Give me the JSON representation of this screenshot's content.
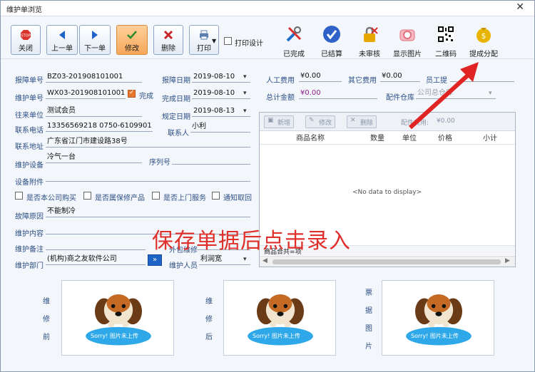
{
  "window": {
    "title": "维护单浏览",
    "close": "✕"
  },
  "toolbar": {
    "close": "关闭",
    "prev": "上一单",
    "next": "下一单",
    "edit": "修改",
    "delete": "删除",
    "print": "打印",
    "print_design": "打印设计",
    "done": "已完成",
    "settled": "已结算",
    "unreviewed": "未审核",
    "show_image": "显示图片",
    "qrcode": "二维码",
    "commission": "提成分配"
  },
  "form": {
    "report_no_label": "报障单号",
    "report_no": "BZ03-201908101001",
    "report_date_label": "报障日期",
    "report_date": "2019-08-10",
    "repair_no_label": "维护单号",
    "repair_no": "WX03-201908101001",
    "done_check_label": "完成",
    "finish_date_label": "完成日期",
    "finish_date": "2019-08-10",
    "unit_label": "往来单位",
    "unit": "测试会员",
    "due_date_label": "规定日期",
    "due_date": "2019-08-13",
    "phone_label": "联系电话",
    "phone": "13356569218 0750-6109901",
    "contact_label": "联系人",
    "contact": "小利",
    "address_label": "联系地址",
    "address": "广东省江门市建设路38号",
    "device_label": "维护设备",
    "device": "冷气一台",
    "serial_label": "序列号",
    "serial": "",
    "attachment_label": "设备附件",
    "attachment": "",
    "opt1": "是否本公司购买",
    "opt2": "是否属保修产品",
    "opt3": "是否上门服务",
    "opt4": "通知取回",
    "fault_label": "故障原因",
    "fault": "不能制冷",
    "content_label": "维护内容",
    "content": "",
    "remark_label": "维护备注",
    "remark": "",
    "outsource_label": "外包维修",
    "dept_label": "维护部门",
    "dept": "(机构)商之友软件公司",
    "staff_label": "维护人员",
    "staff": "利润宽"
  },
  "costs": {
    "labor_label": "人工费用",
    "labor": "¥0.00",
    "other_label": "其它费用",
    "other": "¥0.00",
    "commission_label": "员工提",
    "total_label": "总计金额",
    "total": "¥0.00",
    "warehouse_label": "配件仓库",
    "warehouse": "公司总仓库"
  },
  "grid": {
    "add": "新增",
    "edit": "修改",
    "delete": "删除",
    "parts_fee_label": "配件费用:",
    "parts_fee": "¥0.00",
    "col_name": "商品名称",
    "col_qty": "数量",
    "col_unit": "单位",
    "col_price": "价格",
    "col_subtotal": "小计",
    "empty": "<No data to display>",
    "footer": "商品合共=项"
  },
  "photos": {
    "before": [
      "维",
      "修",
      "前"
    ],
    "after": [
      "维",
      "修",
      "后"
    ],
    "receipt": [
      "票",
      "据",
      "图",
      "片"
    ],
    "placeholder": "Sorry! 图片未上传"
  },
  "overlay": "保存单据后点击录入",
  "colors": {
    "accent": "#e8762d",
    "label": "#2c4f86",
    "overlay": "#e0302c"
  }
}
